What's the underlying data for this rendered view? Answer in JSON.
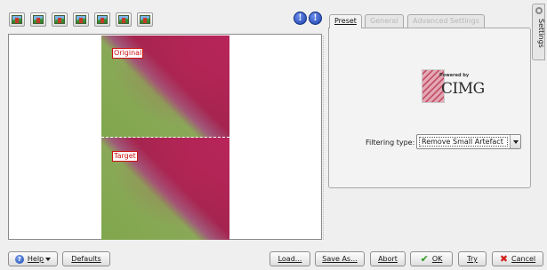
{
  "toolbar": {
    "preview_modes": [
      {
        "icon": "original-image-icon"
      },
      {
        "icon": "split-vertical-icon"
      },
      {
        "icon": "split-horizontal-icon"
      },
      {
        "icon": "split-vertical-duplicate-icon"
      },
      {
        "icon": "split-horizontal-duplicate-icon"
      },
      {
        "icon": "target-image-icon"
      },
      {
        "icon": "compare-image-icon"
      }
    ],
    "info_icons": [
      "overexposure-indicator-icon",
      "underexposure-indicator-icon"
    ],
    "info_glyph": "!"
  },
  "preview": {
    "original_label": "Original",
    "target_label": "Target"
  },
  "tabs": [
    {
      "label": "Preset",
      "state": "active"
    },
    {
      "label": "General",
      "state": "disabled"
    },
    {
      "label": "Advanced Settings",
      "state": "disabled"
    }
  ],
  "settings_panel": {
    "logo_powered": "Powered by",
    "logo_name": "CIMG",
    "filter_label": "Filtering type:",
    "filter_value": "Remove Small Artefact"
  },
  "side_tab": {
    "label": "Settings",
    "icon": "settings-icon"
  },
  "buttons": {
    "help": "Help",
    "defaults": "Defaults",
    "load": "Load...",
    "save_as": "Save As...",
    "abort": "Abort",
    "ok": "OK",
    "try": "Try",
    "cancel": "Cancel"
  },
  "colors": {
    "ok_check": "#2c9a1c",
    "cancel_x": "#d0201a",
    "label_red": "#cc1111",
    "info_blue": "#1a3fa8"
  }
}
